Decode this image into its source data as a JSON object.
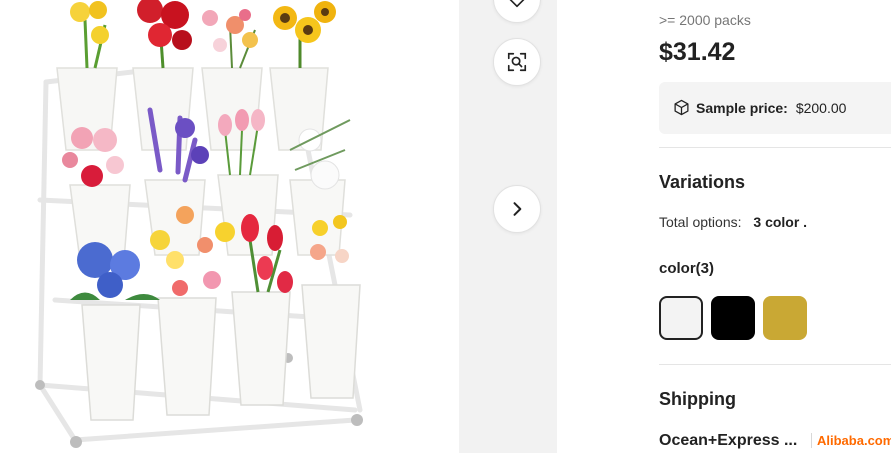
{
  "product": {
    "image_alt": "Flower display stand with white vases"
  },
  "gallery": {
    "icons": {
      "favorite": "heart-icon",
      "image_search": "image-search-icon",
      "next": "chevron-right-icon"
    }
  },
  "pricing": {
    "tier_label": ">= 2000 packs",
    "price": "$31.42",
    "sample_label": "Sample price:",
    "sample_value": "$200.00"
  },
  "variations": {
    "title": "Variations",
    "total_label": "Total options:",
    "total_value": "3 color .",
    "color_label": "color(3)",
    "swatches": [
      {
        "color": "#f3f3f3",
        "selected": true
      },
      {
        "color": "#000000",
        "selected": false
      },
      {
        "color": "#c9a834",
        "selected": false
      }
    ]
  },
  "shipping": {
    "title": "Shipping",
    "method": "Ocean+Express ...",
    "logo_text": "Alibaba.com"
  },
  "colors": {
    "accent": "#ff6a00",
    "price_text": "#222222",
    "muted_text": "#767676"
  }
}
